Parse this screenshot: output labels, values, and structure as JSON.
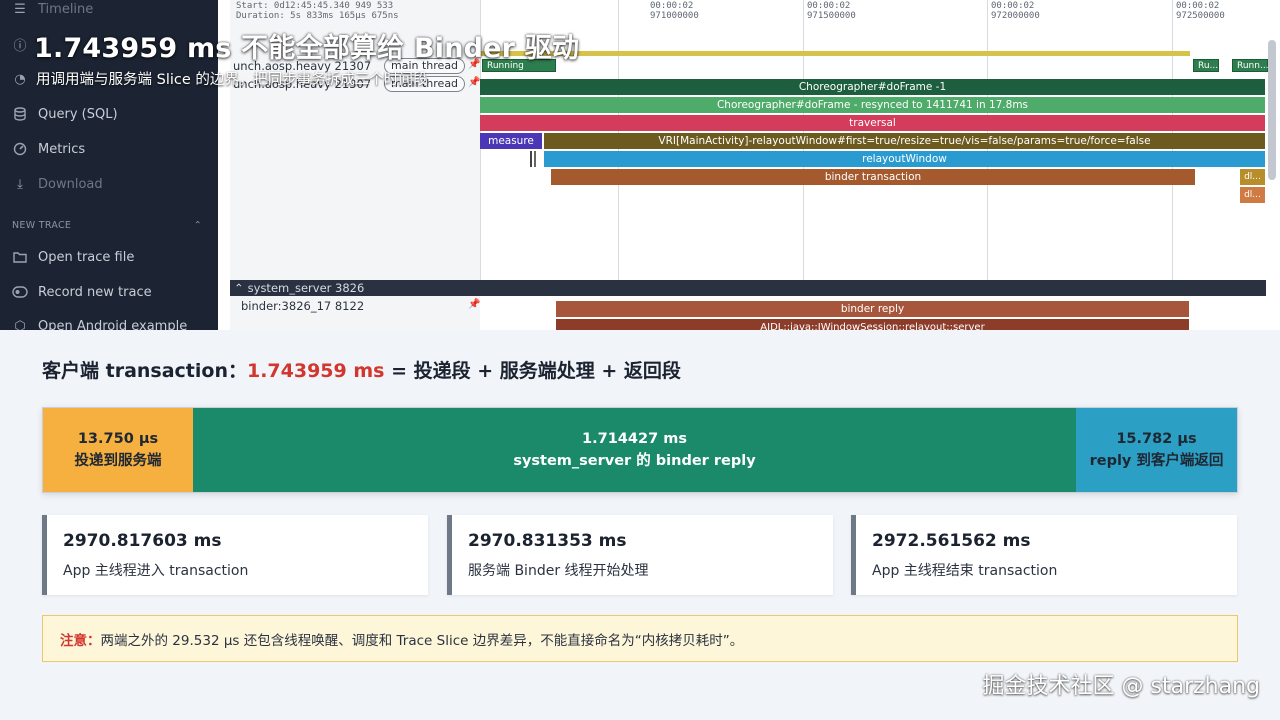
{
  "overlay": {
    "title": "1.743959 ms 不能全部算给 Binder 驱动",
    "subtitle": "用调用端与服务端 Slice 的边界，把同步事务拆成三个时间段"
  },
  "sidebar": {
    "items": [
      {
        "label": "Timeline",
        "icon": "timeline-icon"
      },
      {
        "label": "",
        "icon": "info-icon"
      },
      {
        "label": "",
        "icon": "chart-icon"
      },
      {
        "label": "Query (SQL)",
        "icon": "database-icon"
      },
      {
        "label": "Metrics",
        "icon": "gauge-icon"
      },
      {
        "label": "Download",
        "icon": "download-icon"
      },
      {
        "label": "Open trace file",
        "icon": "folder-icon"
      },
      {
        "label": "Record new trace",
        "icon": "record-icon"
      },
      {
        "label": "Open Android example",
        "icon": "android-icon"
      }
    ],
    "section_label": "NEW TRACE"
  },
  "timeline": {
    "ruler_left": [
      "Start: 0d12:45:45.340 949 533",
      "Duration: 5s 833ms 165µs 675ns"
    ],
    "ticks": [
      {
        "a": "00:00:02",
        "b": "971000000"
      },
      {
        "a": "00:00:02",
        "b": "971500000"
      },
      {
        "a": "00:00:02",
        "b": "972000000"
      },
      {
        "a": "00:00:02",
        "b": "972500000"
      }
    ],
    "app_thread_labels": [
      "unch.aosp.heavy 21307",
      "unch.aosp.heavy 21307"
    ],
    "main_thread_badge": "main thread",
    "states": [
      "Running",
      "Ru...",
      "Runn..."
    ],
    "slices": {
      "doframe": "Choreographer#doFrame -1",
      "resynced": "Choreographer#doFrame - resynced to 1411741 in 17.8ms",
      "traversal": "traversal",
      "measure": "measure",
      "relayout_vri": "VRI[MainActivity]-relayoutWindow#first=true/resize=true/vis=false/params=true/force=false",
      "relayout": "relayoutWindow",
      "binder_tx": "binder transaction",
      "dl1": "dl...",
      "dl2": "dl..."
    },
    "process": "system_server 3826",
    "binder_thread": "binder:3826_17 8122",
    "binder_reply": "binder reply",
    "binder_reply_child": "AIDL::java::IWindowSession::relayout::server"
  },
  "equation": {
    "prefix": "客户端 transaction：",
    "total": "1.743959 ms",
    "rest": " = 投递段 + 服务端处理 + 返回段"
  },
  "segments": [
    {
      "value": "13.750 µs",
      "label": "投递到服务端",
      "fraction": 0.00788,
      "color": "#f6b040",
      "text_color": "#1f2733"
    },
    {
      "value": "1.714427 ms",
      "label": "system_server 的 binder reply",
      "fraction": 0.98307,
      "color": "#1a8a6a",
      "text_color": "#ffffff"
    },
    {
      "value": "15.782 µs",
      "label": "reply 到客户端返回",
      "fraction": 0.00905,
      "color": "#2c9fc4",
      "text_color": "#1f2733"
    }
  ],
  "cards": [
    {
      "num": "2970.817603 ms",
      "desc": "App 主线程进入 transaction"
    },
    {
      "num": "2970.831353 ms",
      "desc": "服务端 Binder 线程开始处理"
    },
    {
      "num": "2972.561562 ms",
      "desc": "App 主线程结束 transaction"
    }
  ],
  "note": {
    "label": "注意：",
    "text": "两端之外的 29.532 µs 还包含线程唤醒、调度和 Trace Slice 边界差异，不能直接命名为“内核拷贝耗时”。"
  },
  "watermark": "掘金技术社区 @ starzhang"
}
